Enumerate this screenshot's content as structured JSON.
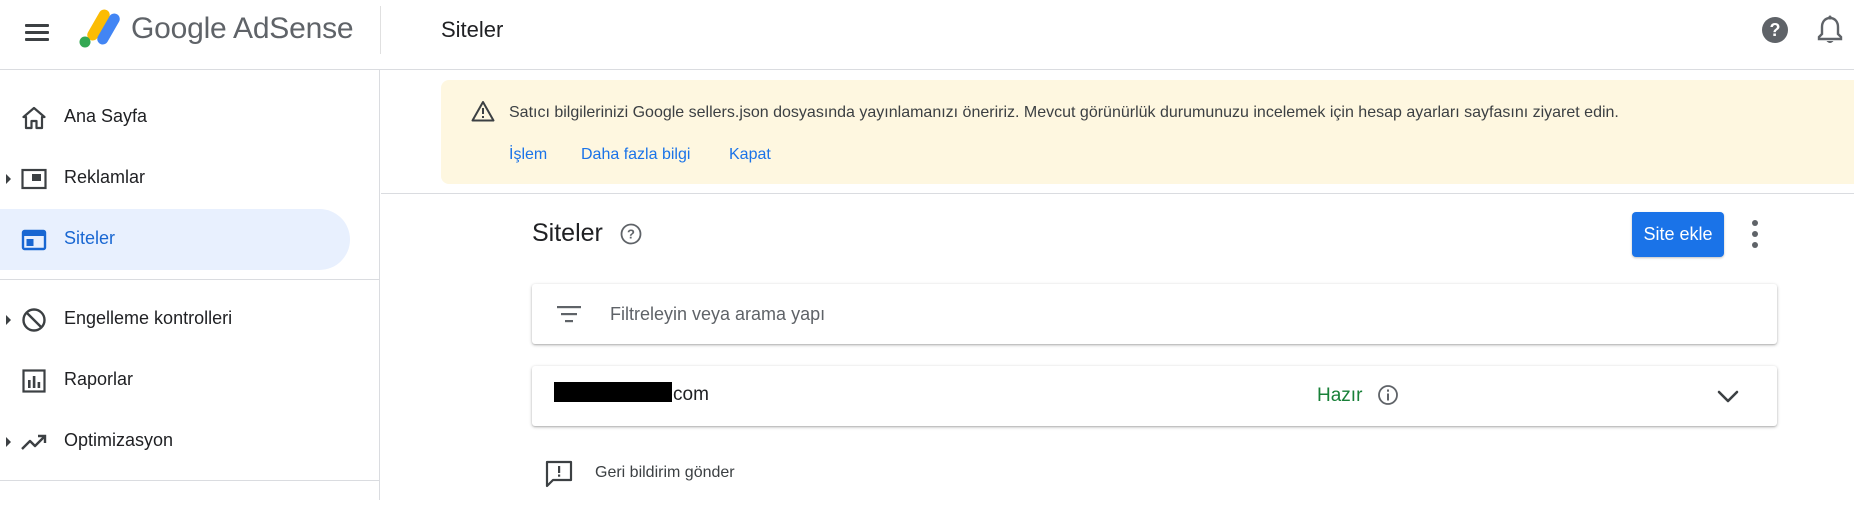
{
  "app": {
    "brand": "Google AdSense",
    "page_title": "Siteler"
  },
  "sidebar": {
    "items": [
      {
        "label": "Ana Sayfa",
        "icon": "home-icon",
        "expandable": false,
        "active": false
      },
      {
        "label": "Reklamlar",
        "icon": "ads-icon",
        "expandable": true,
        "active": false
      },
      {
        "label": "Siteler",
        "icon": "sites-icon",
        "expandable": false,
        "active": true
      },
      {
        "label": "Engelleme kontrolleri",
        "icon": "block-icon",
        "expandable": true,
        "active": false
      },
      {
        "label": "Raporlar",
        "icon": "reports-icon",
        "expandable": false,
        "active": false
      },
      {
        "label": "Optimizasyon",
        "icon": "trending-up-icon",
        "expandable": true,
        "active": false
      }
    ]
  },
  "banner": {
    "message": "Satıcı bilgilerinizi Google sellers.json dosyasında yayınlamanızı öneririz. Mevcut görünürlük durumunuzu incelemek için hesap ayarları sayfasını ziyaret edin.",
    "actions": [
      "İşlem",
      "Daha fazla bilgi",
      "Kapat"
    ],
    "background": "#fef7e0"
  },
  "main": {
    "title": "Siteler",
    "add_button": "Site ekle",
    "search_placeholder": "Filtreleyin veya arama yapı",
    "sites": [
      {
        "domain_suffix": "com",
        "status": "Hazır"
      }
    ],
    "feedback_label": "Geri bildirim gönder"
  },
  "colors": {
    "accent": "#1a73e8",
    "active_nav_bg": "#e8f0fe",
    "status_ready": "#188038"
  }
}
